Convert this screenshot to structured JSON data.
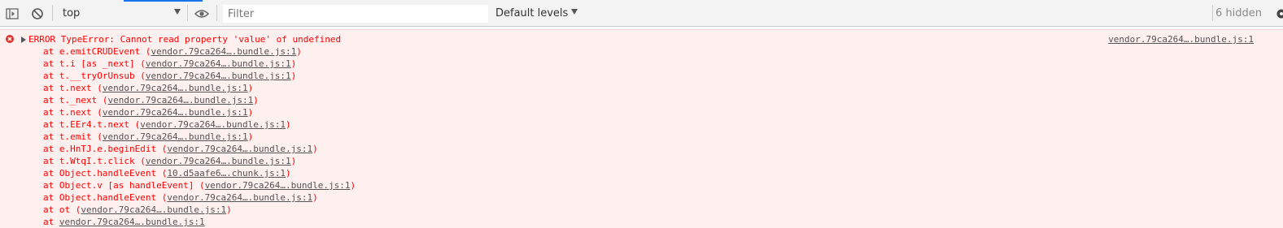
{
  "toolbar": {
    "context": "top",
    "filter_placeholder": "Filter",
    "levels": "Default levels",
    "hidden": "6 hidden",
    "accent_color": "#1a73e8",
    "icons": [
      "toggle-sidebar-icon",
      "clear-console-icon",
      "eye-icon",
      "gear-icon"
    ]
  },
  "console": {
    "error": {
      "header": "ERROR TypeError: Cannot read property 'value' of undefined",
      "source": "vendor.79ca264….bundle.js:1",
      "text_color": "#ff0000",
      "background": "#fff0f0",
      "frames": [
        {
          "prefix": "at e.emitCRUDEvent (",
          "link": "vendor.79ca264….bundle.js:1",
          "suffix": ")"
        },
        {
          "prefix": "at t.i [as _next] (",
          "link": "vendor.79ca264….bundle.js:1",
          "suffix": ")"
        },
        {
          "prefix": "at t.__tryOrUnsub (",
          "link": "vendor.79ca264….bundle.js:1",
          "suffix": ")"
        },
        {
          "prefix": "at t.next (",
          "link": "vendor.79ca264….bundle.js:1",
          "suffix": ")"
        },
        {
          "prefix": "at t._next (",
          "link": "vendor.79ca264….bundle.js:1",
          "suffix": ")"
        },
        {
          "prefix": "at t.next (",
          "link": "vendor.79ca264….bundle.js:1",
          "suffix": ")"
        },
        {
          "prefix": "at t.EEr4.t.next (",
          "link": "vendor.79ca264….bundle.js:1",
          "suffix": ")"
        },
        {
          "prefix": "at t.emit (",
          "link": "vendor.79ca264….bundle.js:1",
          "suffix": ")"
        },
        {
          "prefix": "at e.HnTJ.e.beginEdit (",
          "link": "vendor.79ca264….bundle.js:1",
          "suffix": ")"
        },
        {
          "prefix": "at t.WtqI.t.click (",
          "link": "vendor.79ca264….bundle.js:1",
          "suffix": ")"
        },
        {
          "prefix": "at Object.handleEvent (",
          "link": "10.d5aafe6….chunk.js:1",
          "suffix": ")"
        },
        {
          "prefix": "at Object.v [as handleEvent] (",
          "link": "vendor.79ca264….bundle.js:1",
          "suffix": ")"
        },
        {
          "prefix": "at Object.handleEvent (",
          "link": "vendor.79ca264….bundle.js:1",
          "suffix": ")"
        },
        {
          "prefix": "at ot (",
          "link": "vendor.79ca264….bundle.js:1",
          "suffix": ")"
        },
        {
          "prefix": "at ",
          "link": "vendor.79ca264….bundle.js:1",
          "suffix": ""
        }
      ]
    }
  }
}
